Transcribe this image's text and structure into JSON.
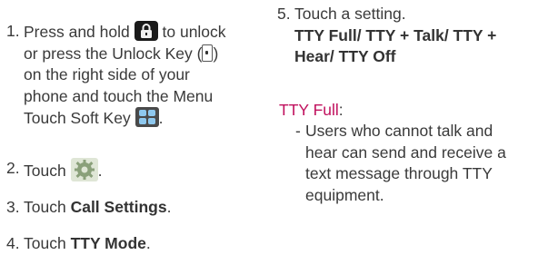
{
  "left": {
    "step1": {
      "num": "1.",
      "part1": "Press and hold",
      "part2": "to unlock",
      "part3": "or press the Unlock Key (",
      "part4": ")",
      "part5": "on the right side of your",
      "part6": "phone and touch the Menu",
      "part7": "Touch Soft Key",
      "part8": "."
    },
    "step2": {
      "num": "2.",
      "text": "Touch",
      "end": "."
    },
    "step3": {
      "num": "3.",
      "text": "Touch",
      "bold": "Call Settings",
      "end": "."
    },
    "step4": {
      "num": "4.",
      "text": "Touch",
      "bold": "TTY Mode",
      "end": "."
    }
  },
  "right": {
    "step5": {
      "num": "5.",
      "text": "Touch a setting.",
      "bold1": "TTY Full/ TTY + Talk/ TTY +",
      "bold2": "Hear/ TTY Off"
    },
    "heading": "TTY Full",
    "heading_colon": ":",
    "desc": {
      "dash": "-",
      "line1": "Users who cannot  talk and",
      "line2": "hear can send and receive a",
      "line3": "text message through TTY",
      "line4": "equipment."
    }
  },
  "icons": {
    "lock": "lock-icon",
    "unlock_key": "side-key-icon",
    "menu": "menu-grid-icon",
    "settings": "settings-gear-icon"
  },
  "colors": {
    "accent": "#c0105d",
    "text": "#3a3a3a"
  }
}
